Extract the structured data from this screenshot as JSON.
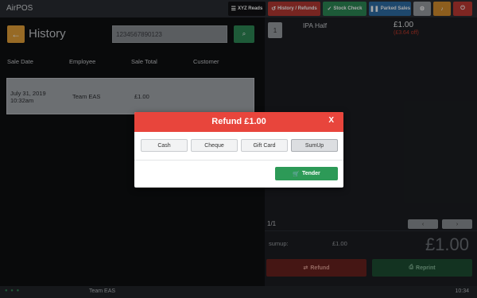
{
  "app": {
    "title": "AirPOS"
  },
  "toolbar": {
    "xyz_reads": "XYZ Reads",
    "history_refunds": "History / Refunds",
    "stock_check": "Stock Check",
    "parked_sales": "Parked Sales"
  },
  "history": {
    "title": "History",
    "search": {
      "value": "1234567890123"
    },
    "columns": [
      "Sale Date",
      "Employee",
      "Sale Total",
      "Customer"
    ],
    "row": {
      "date": "July 31, 2019",
      "time": "10:32am",
      "employee": "Team EAS",
      "total": "£1.00",
      "customer": ""
    }
  },
  "cart": {
    "item": {
      "qty": "1",
      "name": "IPA Half",
      "price": "£1.00",
      "discount": "(£3.64 off)"
    },
    "pager": "1/1",
    "payment": {
      "method": "sumup:",
      "amount": "£1.00"
    },
    "total": "£1.00",
    "refund_label": "Refund",
    "reprint_label": "Reprint"
  },
  "statusbar": {
    "user": "Team EAS",
    "time": "10:34"
  },
  "modal": {
    "title": "Refund £1.00",
    "close": "X",
    "methods": [
      "Cash",
      "Cheque",
      "Gift Card",
      "SumUp"
    ],
    "selected_method": "SumUp",
    "tender_label": "Tender"
  },
  "colors": {
    "accent_orange": "#e8a33a",
    "danger_red": "#e8453c",
    "success_green": "#2d9a57",
    "topbar_bg": "#2a2d33"
  },
  "icons": [
    "arrow-left-icon",
    "search-icon",
    "list-icon",
    "refresh-icon",
    "check-icon",
    "pause-icon",
    "gear-icon",
    "bell-icon",
    "power-icon",
    "chevron-left-icon",
    "chevron-right-icon",
    "refund-icon",
    "print-icon",
    "cart-icon"
  ]
}
